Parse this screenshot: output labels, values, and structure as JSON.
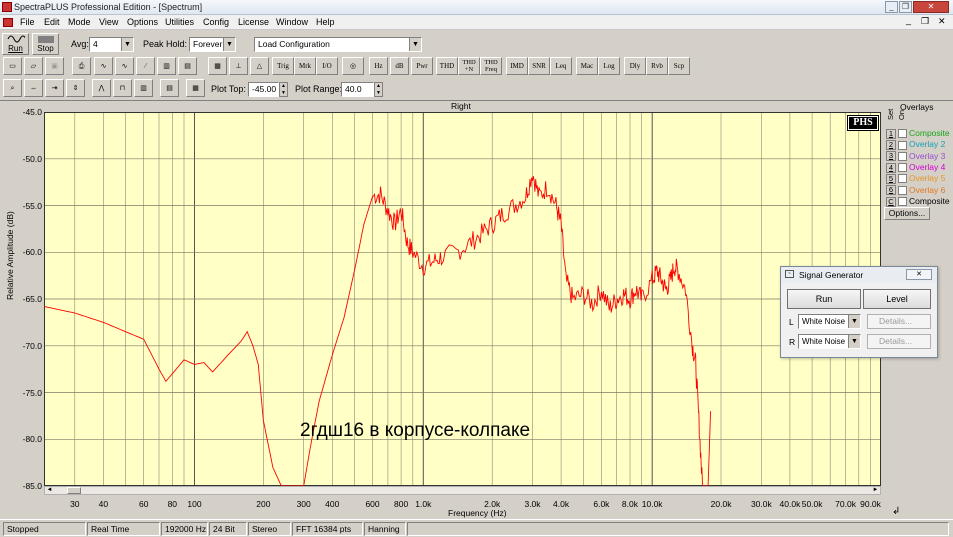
{
  "window": {
    "title": "SpectraPLUS Professional Edition - [Spectrum]",
    "min": "_",
    "restore": "❐",
    "close": "✕",
    "inner_min": "_",
    "inner_restore": "❐",
    "inner_close": "✕"
  },
  "menu": [
    "File",
    "Edit",
    "Mode",
    "View",
    "Options",
    "Utilities",
    "Config",
    "License",
    "Window",
    "Help"
  ],
  "toolbar1": {
    "run_label": "Run",
    "stop_label": "Stop",
    "avg_label": "Avg:",
    "avg_value": "4",
    "peak_hold_label": "Peak Hold:",
    "peak_hold_value": "Forever",
    "config_value": "Load Configuration"
  },
  "toolbar2": [
    "THD",
    "THD +N",
    "THD Freq",
    "IMD",
    "SNR",
    "Leq",
    "Mac",
    "Log",
    "Dly",
    "Rvb",
    "Scp",
    "Hz",
    "dB",
    "Pwr",
    "Trig",
    "Mrk",
    "I/O",
    "Tfm"
  ],
  "toolbar3": {
    "plot_top_label": "Plot Top:",
    "plot_top_value": "-45.00",
    "plot_range_label": "Plot Range:",
    "plot_range_value": "40.0"
  },
  "chart_data": {
    "type": "line",
    "title": "Right",
    "xlabel": "Frequency (Hz)",
    "ylabel": "Relative Amplitude (dB)",
    "x_scale": "log",
    "xlim": [
      22,
      100000
    ],
    "ylim": [
      -85,
      -45
    ],
    "grid": true,
    "y_ticks": [
      "-45.0",
      "-50.0",
      "-55.0",
      "-60.0",
      "-65.0",
      "-70.0",
      "-75.0",
      "-80.0",
      "-85.0"
    ],
    "x_ticks": [
      "30",
      "40",
      "60",
      "80",
      "100",
      "200",
      "300",
      "400",
      "600",
      "800",
      "1.0k",
      "2.0k",
      "3.0k",
      "4.0k",
      "6.0k",
      "8.0k",
      "10.0k",
      "20.0k",
      "30.0k",
      "40.0k",
      "50.0k",
      "70.0k",
      "90.0k"
    ],
    "annotation": "2гдш16 в корпусе-колпаке",
    "logo": "PHS",
    "series": [
      {
        "color": "#ff0000",
        "x": [
          22,
          30,
          40,
          50,
          60,
          70,
          75,
          80,
          90,
          100,
          110,
          120,
          140,
          160,
          170,
          180,
          190,
          200,
          220,
          250,
          280,
          300,
          320,
          350,
          400,
          450,
          500,
          550,
          600,
          650,
          700,
          750,
          800,
          850,
          900,
          1000,
          1100,
          1200,
          1400,
          1600,
          1800,
          2000,
          2200,
          2500,
          2800,
          3000,
          3200,
          3500,
          3800,
          4000,
          4200,
          4500,
          5000,
          5500,
          6000,
          6500,
          7000,
          7500,
          8000,
          8500,
          9000,
          10000,
          10500,
          11000,
          11500,
          12000,
          12500,
          13000,
          14000,
          15000,
          15500,
          16000,
          16500,
          17000,
          17500,
          18000
        ],
        "y": [
          -65.8,
          -66.5,
          -67.5,
          -68.5,
          -69.3,
          -72.5,
          -73.8,
          -73,
          -71.5,
          -72,
          -71.8,
          -72.8,
          -71,
          -69.5,
          -68.5,
          -70,
          -72,
          -78,
          -83,
          -86,
          -86,
          -85,
          -81,
          -76,
          -71,
          -67,
          -62,
          -57,
          -54,
          -53.8,
          -55.5,
          -57,
          -55.5,
          -59,
          -60,
          -61.5,
          -61,
          -60.5,
          -60,
          -59,
          -58,
          -57,
          -56,
          -55,
          -54,
          -51.5,
          -54,
          -53,
          -55,
          -57,
          -63,
          -65,
          -64.5,
          -65.5,
          -64,
          -66,
          -65,
          -64.5,
          -65,
          -64,
          -65,
          -63,
          -62,
          -63,
          -64,
          -63,
          -61.5,
          -62,
          -64,
          -70,
          -72,
          -78,
          -84,
          -88,
          -86,
          -77
        ]
      }
    ]
  },
  "overlays": {
    "title": "Overlays",
    "set_label": "Set",
    "on_label": "On",
    "options_label": "Options...",
    "items": [
      {
        "num": "1",
        "label": "Composite",
        "color": "#19a519"
      },
      {
        "num": "2",
        "label": "Overlay 2",
        "color": "#14a0b4"
      },
      {
        "num": "3",
        "label": "Overlay 3",
        "color": "#9b4bd2"
      },
      {
        "num": "4",
        "label": "Overlay 4",
        "color": "#d200d2"
      },
      {
        "num": "5",
        "label": "Overlay 5",
        "color": "#e6961e"
      },
      {
        "num": "6",
        "label": "Overlay 6",
        "color": "#e6781e"
      },
      {
        "num": "C",
        "label": "Composite",
        "color": "#000000"
      }
    ]
  },
  "signal_generator": {
    "title": "Signal Generator",
    "close": "✕",
    "run_label": "Run",
    "level_label": "Level",
    "left_channel": "L",
    "left_value": "White Noise",
    "left_details": "Details...",
    "right_channel": "R",
    "right_value": "White Noise",
    "right_details": "Details..."
  },
  "status": [
    "Stopped",
    "Real Time",
    "192000 Hz",
    "24 Bit",
    "Stereo",
    "FFT 16384 pts",
    "Hanning"
  ]
}
